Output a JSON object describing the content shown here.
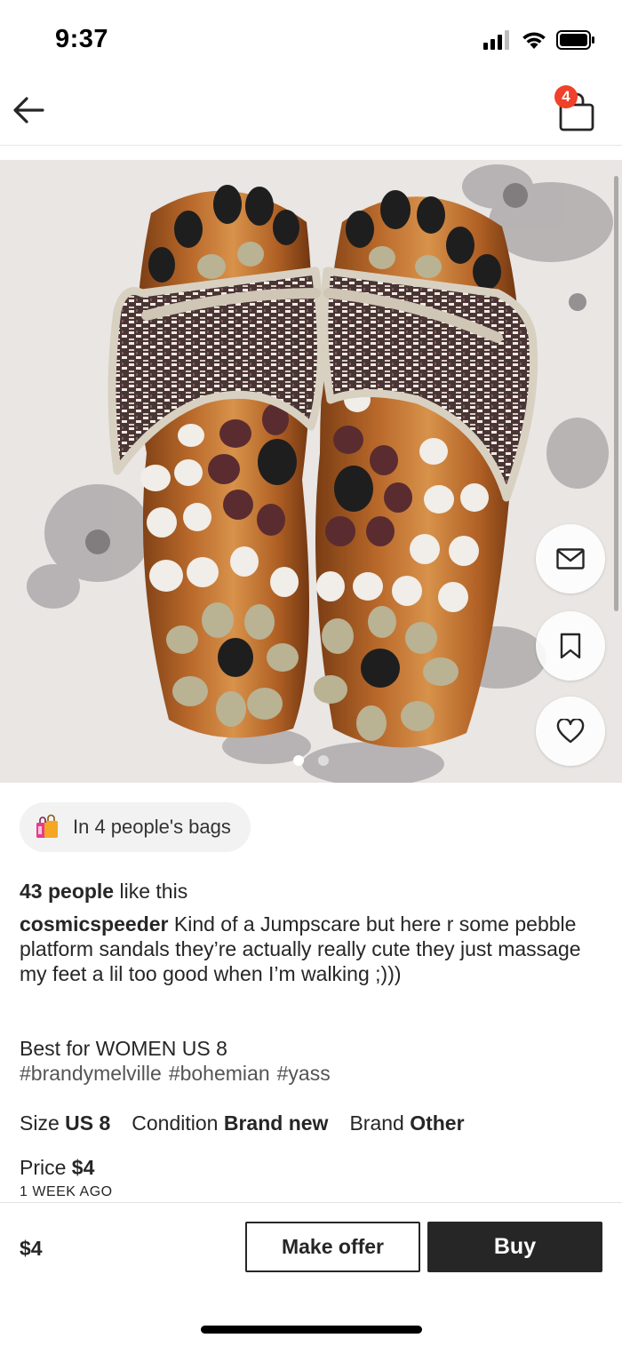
{
  "status_bar": {
    "time": "9:37"
  },
  "nav": {
    "bag_count": "4"
  },
  "gallery": {
    "image_count": 2,
    "active_index": 0
  },
  "bags": {
    "text": "In 4 people's bags"
  },
  "likes": {
    "count": "43 people",
    "suffix": " like this"
  },
  "listing": {
    "seller": "cosmicspeeder",
    "description": " Kind of a Jumpscare but here r some pebble platform sandals they’re actually really cute they just massage my feet a lil too good when I’m walking ;)))",
    "best_for": "Best for WOMEN US 8",
    "tags": [
      "#brandymelville",
      "#bohemian",
      "#yass"
    ],
    "size_label": "Size",
    "size_value": "US 8",
    "condition_label": "Condition",
    "condition_value": "Brand new",
    "brand_label": "Brand",
    "brand_value": "Other",
    "price_label": "Price",
    "price_value": "$4",
    "posted": "1 WEEK AGO"
  },
  "bottom_bar": {
    "price": "$4",
    "offer_label": "Make offer",
    "buy_label": "Buy"
  },
  "actions": {
    "message_icon": "envelope-icon",
    "save_icon": "bookmark-icon",
    "like_icon": "heart-icon"
  },
  "colors": {
    "badge": "#f0412a",
    "dark": "#262626"
  }
}
